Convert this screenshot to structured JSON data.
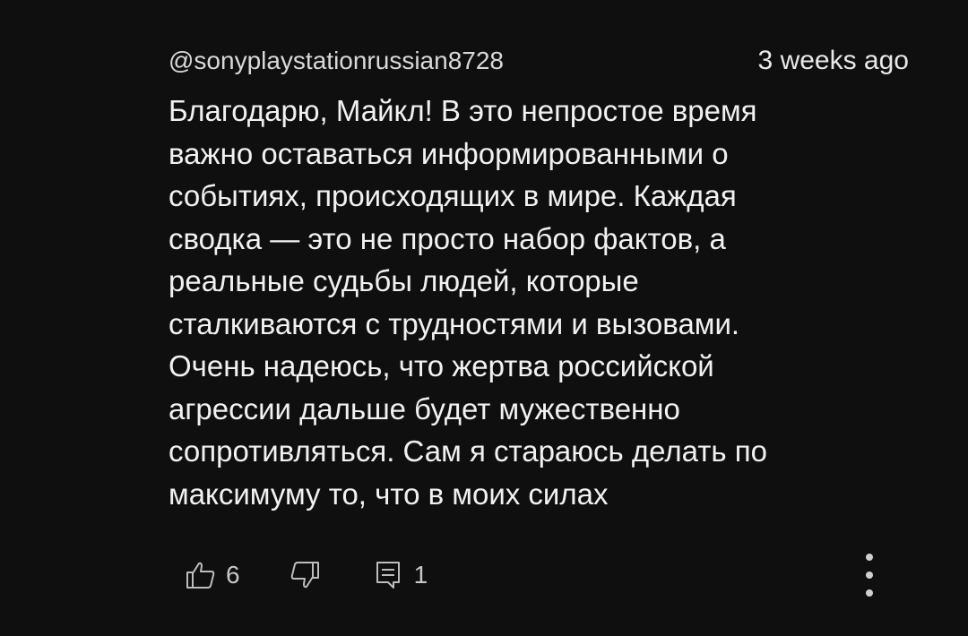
{
  "comment": {
    "author": "@sonyplaystationrussian8728",
    "time": "3 weeks ago",
    "text_lines": [
      "Благодарю, Майкл! В это непростое время",
      "важно оставаться информированными о",
      "событиях, происходящих в мире. Каждая",
      "сводка — это не просто набор фактов, а",
      "реальные судьбы людей, которые",
      "сталкиваются с трудностями и вызовами.",
      "Очень надеюсь, что жертва российской",
      "агрессии дальше будет мужественно",
      "сопротивляться. Сам я стараюсь делать по",
      "максимуму то, что в моих силах"
    ]
  },
  "actions": {
    "likes": "6",
    "replies": "1",
    "icons": {
      "like": "thumbs-up-icon",
      "dislike": "thumbs-down-icon",
      "reply": "reply-comment-icon",
      "more": "more-vertical-icon"
    }
  }
}
